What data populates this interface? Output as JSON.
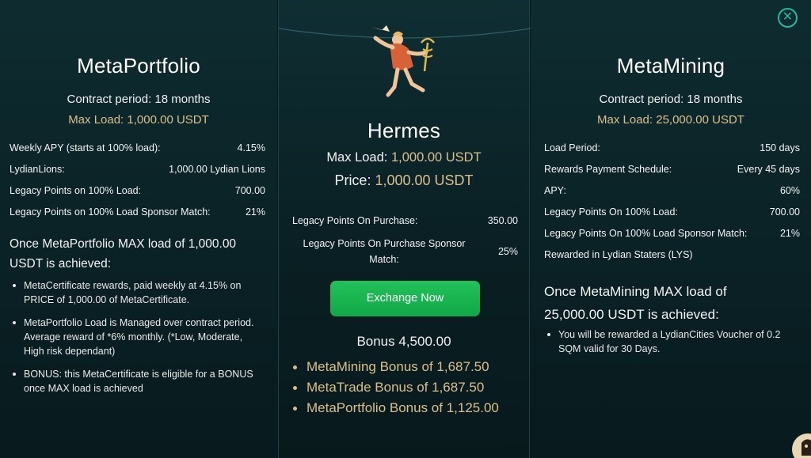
{
  "left": {
    "title": "MetaPortfolio",
    "contract": "Contract period: 18 months",
    "max_load": "Max Load: 1,000.00 USDT",
    "rows": [
      {
        "label": "Weekly APY (starts at 100% load):",
        "value": "4.15%"
      },
      {
        "label": "LydianLions:",
        "value": "1,000.00 Lydian Lions"
      },
      {
        "label": "Legacy Points on 100% Load:",
        "value": "700.00"
      },
      {
        "label": "Legacy Points on 100% Load Sponsor Match:",
        "value": "21%"
      }
    ],
    "lead_line1": "Once MetaPortfolio MAX load of 1,000.00",
    "lead_line2": "USDT is achieved:",
    "bullets": [
      "MetaCertificate rewards, paid weekly at 4.15% on PRICE of 1,000.00 of MetaCertificate.",
      "MetaPortfolio Load is Managed over contract period. Average reward of *6% monthly. (*Low, Moderate, High risk dependant)",
      "BONUS: this MetaCertificate is eligible for a BONUS once MAX load is achieved"
    ]
  },
  "center": {
    "title": "Hermes",
    "max_load_label": "Max Load:",
    "max_load_value": "1,000.00 USDT",
    "price_label": "Price:",
    "price_value": "1,000.00 USDT",
    "rows": [
      {
        "label": "Legacy Points On Purchase:",
        "value": "350.00"
      },
      {
        "label": "Legacy Points On Purchase Sponsor Match:",
        "value": "25%"
      }
    ],
    "button": "Exchange Now",
    "bonus_title": "Bonus 4,500.00",
    "bonuses": [
      "MetaMining Bonus of 1,687.50",
      "MetaTrade Bonus of 1,687.50",
      "MetaPortfolio Bonus of 1,125.00"
    ]
  },
  "right": {
    "title": "MetaMining",
    "contract": "Contract period: 18 months",
    "max_load": "Max Load: 25,000.00 USDT",
    "rows": [
      {
        "label": "Load Period:",
        "value": "150 days"
      },
      {
        "label": "Rewards Payment Schedule:",
        "value": "Every 45 days"
      },
      {
        "label": "APY:",
        "value": "60%"
      },
      {
        "label": "Legacy Points On 100% Load:",
        "value": "700.00"
      },
      {
        "label": "Legacy Points On 100% Load Sponsor Match:",
        "value": "21%"
      },
      {
        "label": "Rewarded in Lydian Staters (LYS)",
        "value": ""
      }
    ],
    "lead_line1": "Once MetaMining MAX load of",
    "lead_line2": "25,000.00 USDT is achieved:",
    "bullets": [
      "You will be rewarded a LydianCities Voucher of 0.2 SQM valid for 30 Days."
    ]
  },
  "close_icon": "close-icon",
  "colors": {
    "gold": "#d9c08a",
    "button_green": "#1db954",
    "accent_teal": "#22b9a0",
    "background": "#0b2327"
  }
}
